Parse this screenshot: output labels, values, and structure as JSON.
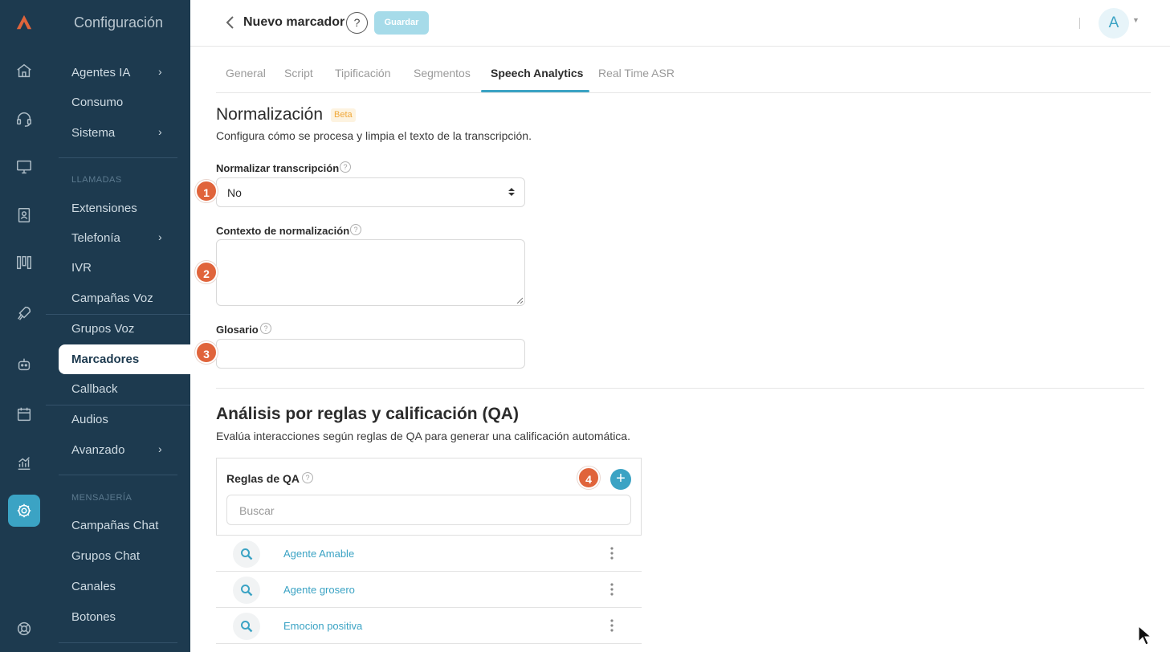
{
  "sidebar": {
    "title": "Configuración",
    "items": [
      {
        "label": "Agentes IA",
        "arrow": "›"
      },
      {
        "label": "Consumo"
      },
      {
        "label": "Sistema",
        "arrow": "›"
      },
      {
        "section": "LLAMADAS"
      },
      {
        "label": "Extensiones"
      },
      {
        "label": "Telefonía",
        "arrow": "›"
      },
      {
        "label": "IVR"
      },
      {
        "label": "Campañas Voz"
      },
      {
        "label": "Grupos Voz"
      },
      {
        "label": "Marcadores",
        "active": true
      },
      {
        "label": "Callback"
      },
      {
        "label": "Audios"
      },
      {
        "label": "Avanzado",
        "arrow": "›"
      },
      {
        "section": "MENSAJERÍA"
      },
      {
        "label": "Campañas Chat"
      },
      {
        "label": "Grupos Chat"
      },
      {
        "label": "Canales"
      },
      {
        "label": "Botones"
      }
    ]
  },
  "rail_icons": [
    "logo-icon",
    "home-icon",
    "headset-icon",
    "monitor-icon",
    "contacts-icon",
    "bars-icon",
    "rocket-icon",
    "robot-icon",
    "calendar-icon",
    "chart-icon",
    "settings-icon",
    "support-icon"
  ],
  "header": {
    "title": "Nuevo marcador",
    "help": "?",
    "save_label": "Guardar",
    "avatar": "A"
  },
  "tabs": [
    "General",
    "Script",
    "Tipificación",
    "Segmentos",
    "Speech Analytics",
    "Real Time ASR"
  ],
  "active_tab": "Speech Analytics",
  "normalizacion": {
    "title": "Normalización",
    "badge": "Beta",
    "description": "Configura cómo se procesa y limpia el texto de la transcripción.",
    "normalizar_label": "Normalizar transcripción",
    "normalizar_value": "No",
    "contexto_label": "Contexto de normalización",
    "contexto_value": "",
    "glosario_label": "Glosario",
    "glosario_value": ""
  },
  "qa": {
    "title": "Análisis por reglas y calificación (QA)",
    "description": "Evalúa interacciones según reglas de QA para generar una calificación automática.",
    "rules_label": "Reglas de QA",
    "search_placeholder": "Buscar",
    "add_label": "+",
    "rules": [
      "Agente Amable",
      "Agente grosero",
      "Emocion positiva"
    ]
  },
  "markers": [
    "1",
    "2",
    "3",
    "4"
  ],
  "colors": {
    "sidebar": "#1d3a4f",
    "accent": "#3ba3c4",
    "marker": "#e0643b",
    "badge": "#f0a83a"
  }
}
